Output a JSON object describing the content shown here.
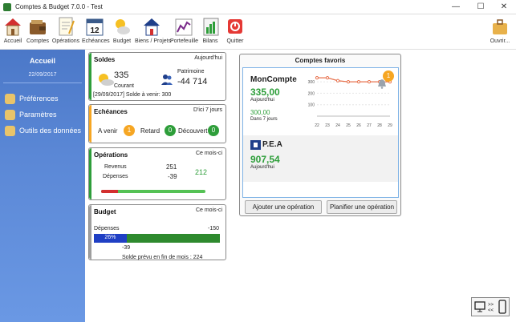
{
  "window": {
    "title": "Comptes & Budget 7.0.0 - Test",
    "minimize": "—",
    "maximize": "☐",
    "close": "✕"
  },
  "toolbar": {
    "accueil": "Accueil",
    "comptes": "Comptes",
    "operations": "Opérations",
    "echeances": "Echéances",
    "calendar_day": "12",
    "budget": "Budget",
    "biens": "Biens / Projets",
    "portefeuille": "Portefeuille",
    "bilans": "Bilans",
    "quitter": "Quitter",
    "ouvrir": "Ouvrir..."
  },
  "sidebar": {
    "header": "Accueil",
    "date": "22/09/2017",
    "items": [
      {
        "label": "Préférences"
      },
      {
        "label": "Paramètres"
      },
      {
        "label": "Outils des données"
      }
    ]
  },
  "soldes": {
    "title": "Soldes",
    "period": "Aujourd'hui",
    "courant_value": "335",
    "courant_label": "Courant",
    "patrimoine_label": "Patrimoine",
    "patrimoine_value": "-44 714",
    "footer": "[29/09/2017] Solde à venir: 300"
  },
  "echeances": {
    "title": "Echéances",
    "period": "D'ici 7 jours",
    "avenir_label": "A venir",
    "avenir_count": "1",
    "retard_label": "Retard",
    "retard_count": "0",
    "decouvert_label": "Découvert",
    "decouvert_count": "0"
  },
  "operations": {
    "title": "Opérations",
    "period": "Ce mois-ci",
    "revenus_label": "Revenus",
    "revenus_value": "251",
    "depenses_label": "Dépenses",
    "depenses_value": "-39",
    "net": "212",
    "expense_ratio": 0.16
  },
  "budget": {
    "title": "Budget",
    "period": "Ce mois-ci",
    "depenses_label": "Dépenses",
    "total": "-150",
    "percent_label": "26%",
    "percent": 0.26,
    "spent": "-39",
    "footer": "Solde prévu en fin de mois : 224"
  },
  "favoris": {
    "title": "Comptes favoris",
    "moncompte": {
      "name": "MonCompte",
      "balance": "335,00",
      "balance_caption": "Aujourd'hui",
      "future": "300,00",
      "future_caption": "Dans 7 jours",
      "badge": "1"
    },
    "pea": {
      "name": "P.E.A",
      "balance": "907,54",
      "balance_caption": "Aujourd'hui"
    },
    "add_button": "Ajouter une opération",
    "plan_button": "Planifier une opération"
  },
  "chart_data": {
    "type": "line",
    "x": [
      "22",
      "23",
      "24",
      "25",
      "26",
      "27",
      "28",
      "29"
    ],
    "y_ticks": [
      "100",
      "200",
      "300"
    ],
    "ylim": [
      0,
      350
    ],
    "series": [
      {
        "color": "#e8734f",
        "values": [
          335,
          335,
          310,
          300,
          300,
          300,
          300,
          300
        ]
      }
    ],
    "grid": true
  },
  "colors": {
    "green": "#2e9e3a",
    "red": "#d32f2f",
    "blue": "#1f3fc4",
    "orange": "#f6a623",
    "accent_line": "#e8734f"
  }
}
